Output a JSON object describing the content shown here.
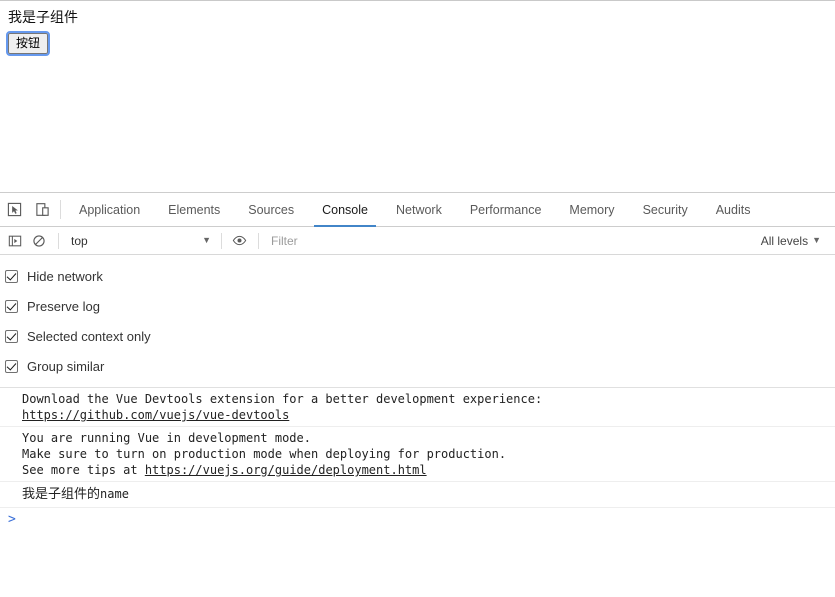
{
  "page": {
    "heading": "我是子组件",
    "button_label": "按钮"
  },
  "devtools": {
    "left_icons": [
      {
        "name": "inspect-element-icon",
        "title": "Inspect element"
      },
      {
        "name": "device-toolbar-icon",
        "title": "Toggle device toolbar"
      }
    ],
    "tabs": [
      {
        "label": "Application",
        "active": false
      },
      {
        "label": "Elements",
        "active": false
      },
      {
        "label": "Sources",
        "active": false
      },
      {
        "label": "Console",
        "active": true
      },
      {
        "label": "Network",
        "active": false
      },
      {
        "label": "Performance",
        "active": false
      },
      {
        "label": "Memory",
        "active": false
      },
      {
        "label": "Security",
        "active": false
      },
      {
        "label": "Audits",
        "active": false
      }
    ],
    "active_tab": "Console",
    "accent_color": "#4285c8"
  },
  "console_toolbar": {
    "sidebar_icon": "show-console-sidebar-icon",
    "clear_icon": "clear-console-icon",
    "context_value": "top",
    "eye_icon": "live-expression-eye-icon",
    "filter_placeholder": "Filter",
    "filter_value": "",
    "levels_label": "All levels"
  },
  "settings": {
    "options": [
      {
        "label": "Hide network",
        "checked": true
      },
      {
        "label": "Preserve log",
        "checked": true
      },
      {
        "label": "Selected context only",
        "checked": true
      },
      {
        "label": "Group similar",
        "checked": true
      }
    ]
  },
  "console_messages": [
    {
      "lines": [
        "Download the Vue Devtools extension for a better development experience:",
        "https://github.com/vuejs/vue-devtools"
      ],
      "link_line_index": 1
    },
    {
      "lines": [
        "You are running Vue in development mode.",
        "Make sure to turn on production mode when deploying for production.",
        "See more tips at "
      ],
      "trailing_link": "https://vuejs.org/guide/deployment.html"
    },
    {
      "cjk_text": "我是子组件的",
      "mono_text": "name"
    }
  ],
  "prompt": {
    "caret": ">",
    "value": ""
  }
}
